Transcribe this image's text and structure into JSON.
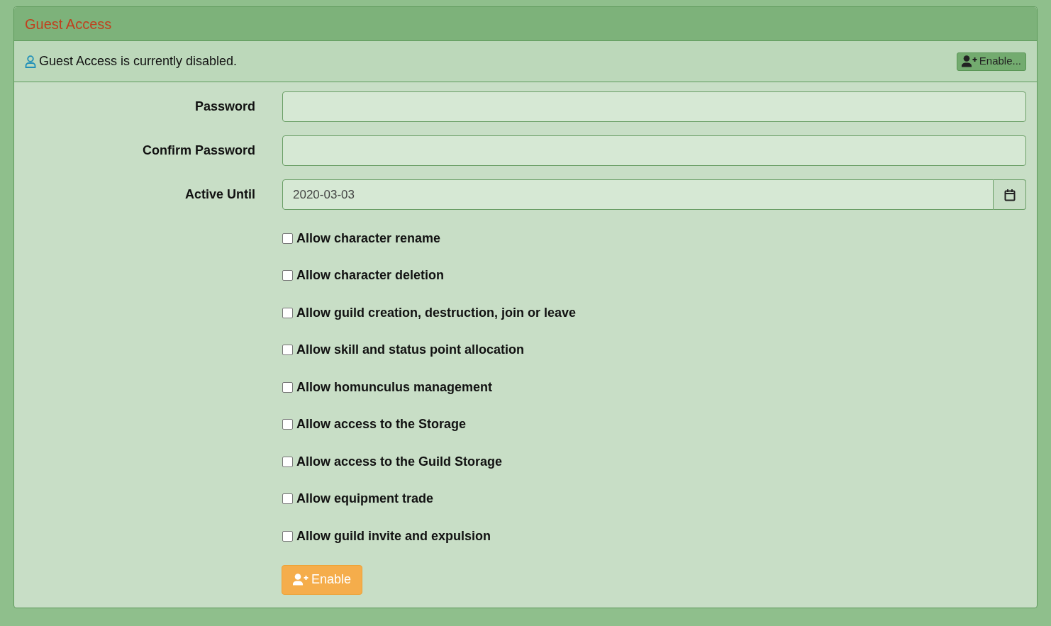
{
  "panel": {
    "title": "Guest Access"
  },
  "status": {
    "message": "Guest Access is currently disabled.",
    "button": "Enable..."
  },
  "fields": [
    {
      "label": "Password",
      "kind": "password"
    },
    {
      "label": "Confirm Password",
      "kind": "password"
    },
    {
      "label": "Active Until",
      "kind": "date",
      "value": "2020-03-03"
    }
  ],
  "permissions": [
    {
      "label": "Allow character rename",
      "checked": false
    },
    {
      "label": "Allow character deletion",
      "checked": false
    },
    {
      "label": "Allow guild creation, destruction, join or leave",
      "checked": false
    },
    {
      "label": "Allow skill and status point allocation",
      "checked": false
    },
    {
      "label": "Allow homunculus management",
      "checked": false
    },
    {
      "label": "Allow access to the Storage",
      "checked": false
    },
    {
      "label": "Allow access to the Guild Storage",
      "checked": false
    },
    {
      "label": "Allow equipment trade",
      "checked": false
    },
    {
      "label": "Allow guild invite and expulsion",
      "checked": false
    }
  ],
  "submit": {
    "label": "Enable"
  }
}
